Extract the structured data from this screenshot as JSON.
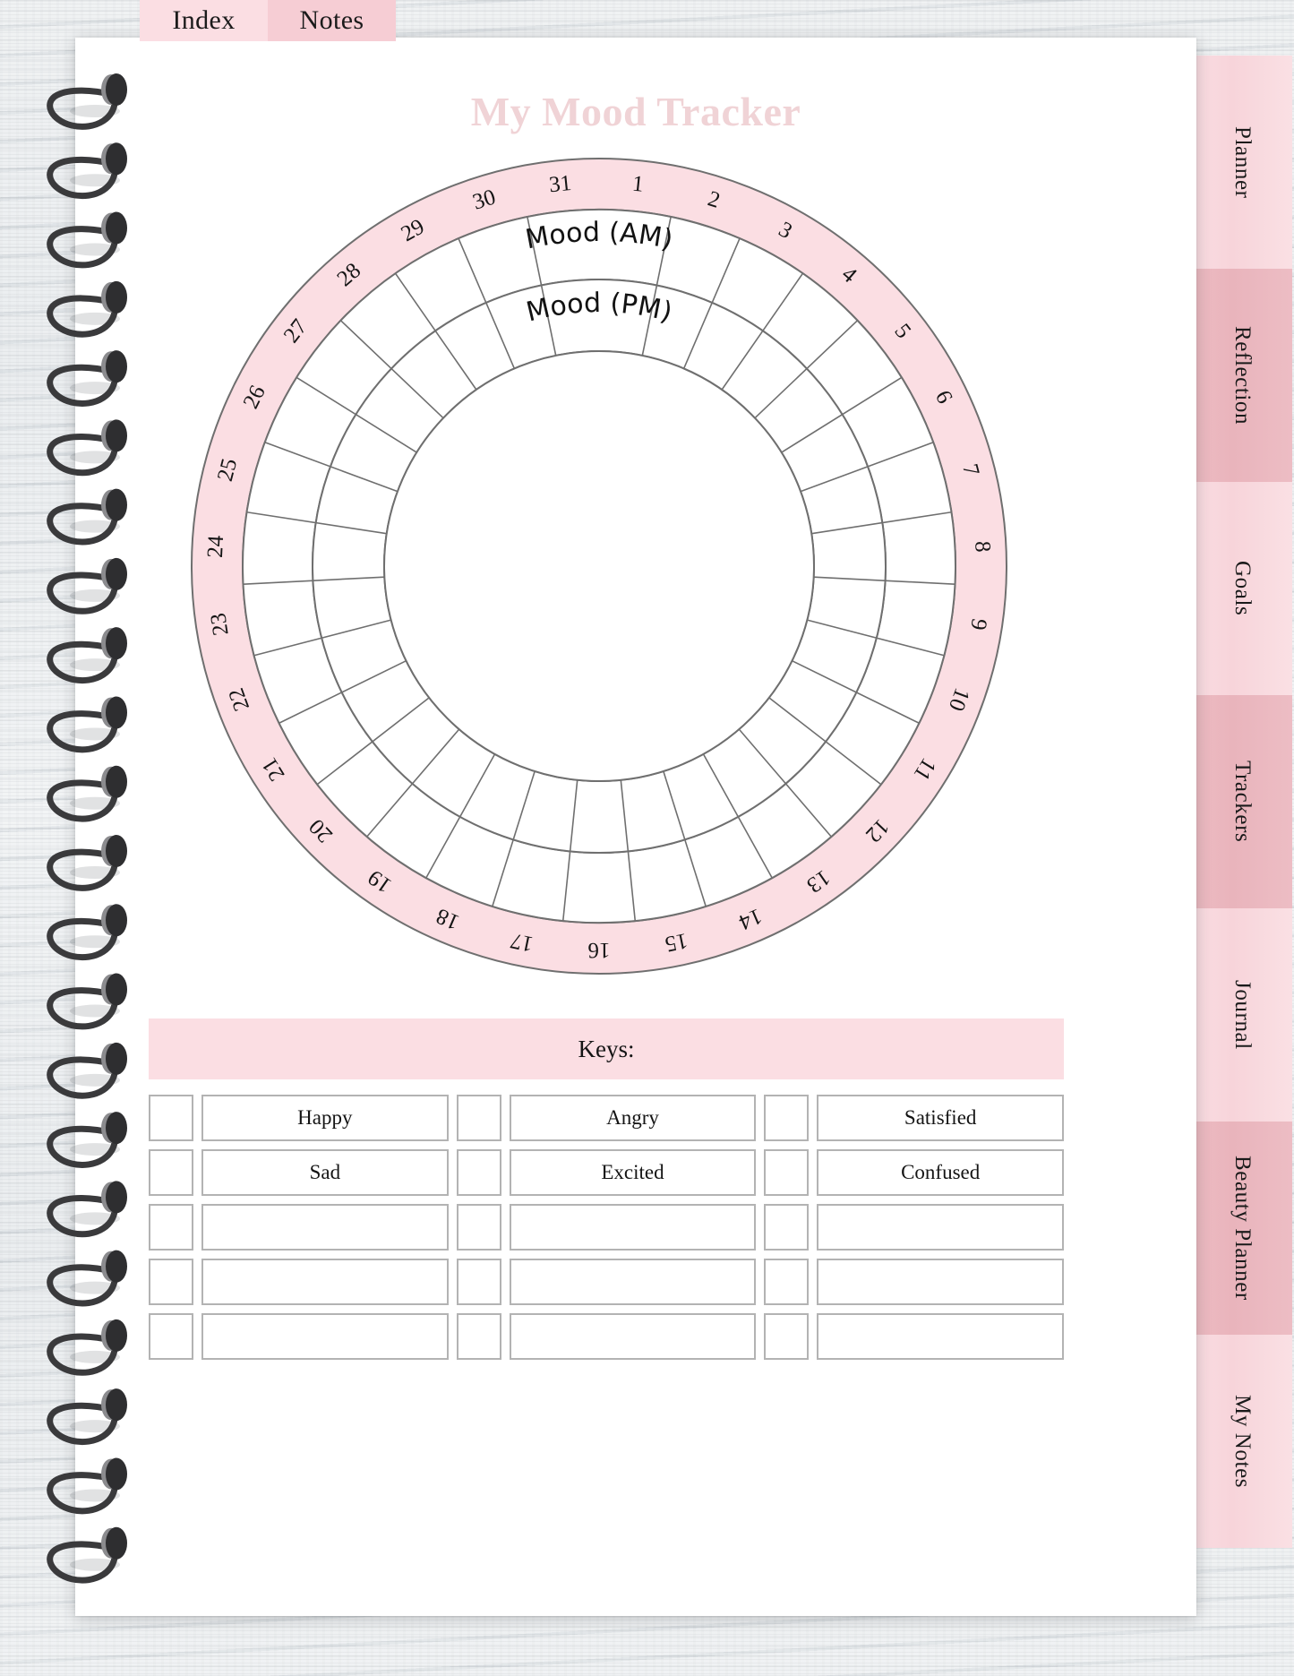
{
  "top_tabs": [
    {
      "label": "Index"
    },
    {
      "label": "Notes"
    }
  ],
  "side_tabs": [
    {
      "label": "Planner"
    },
    {
      "label": "Reflection"
    },
    {
      "label": "Goals"
    },
    {
      "label": "Trackers"
    },
    {
      "label": "Journal"
    },
    {
      "label": "Beauty Planner"
    },
    {
      "label": "My Notes"
    }
  ],
  "page": {
    "title": "My Mood Tracker"
  },
  "wheel": {
    "ring_labels": [
      {
        "label": "Mood (AM)"
      },
      {
        "label": "Mood (PM)"
      }
    ],
    "days": [
      "1",
      "2",
      "3",
      "4",
      "5",
      "6",
      "7",
      "8",
      "9",
      "10",
      "11",
      "12",
      "13",
      "14",
      "15",
      "16",
      "17",
      "18",
      "19",
      "20",
      "21",
      "22",
      "23",
      "24",
      "25",
      "26",
      "27",
      "28",
      "29",
      "30",
      "31"
    ]
  },
  "keys": {
    "heading": "Keys:",
    "rows": [
      {
        "cells": [
          {
            "label": "Happy"
          },
          {
            "label": "Angry"
          },
          {
            "label": "Satisfied"
          }
        ]
      },
      {
        "cells": [
          {
            "label": "Sad"
          },
          {
            "label": "Excited"
          },
          {
            "label": "Confused"
          }
        ]
      },
      {
        "cells": [
          {
            "label": ""
          },
          {
            "label": ""
          },
          {
            "label": ""
          }
        ]
      },
      {
        "cells": [
          {
            "label": ""
          },
          {
            "label": ""
          },
          {
            "label": ""
          }
        ]
      },
      {
        "cells": [
          {
            "label": ""
          },
          {
            "label": ""
          },
          {
            "label": ""
          }
        ]
      }
    ]
  },
  "colors": {
    "accent_pink": "#fbdee3",
    "accent_pink_dark": "#eebcc3",
    "title_pink": "#f0d3d6",
    "line_gray": "#6f6f6f",
    "box_border": "#b3b3b3"
  }
}
